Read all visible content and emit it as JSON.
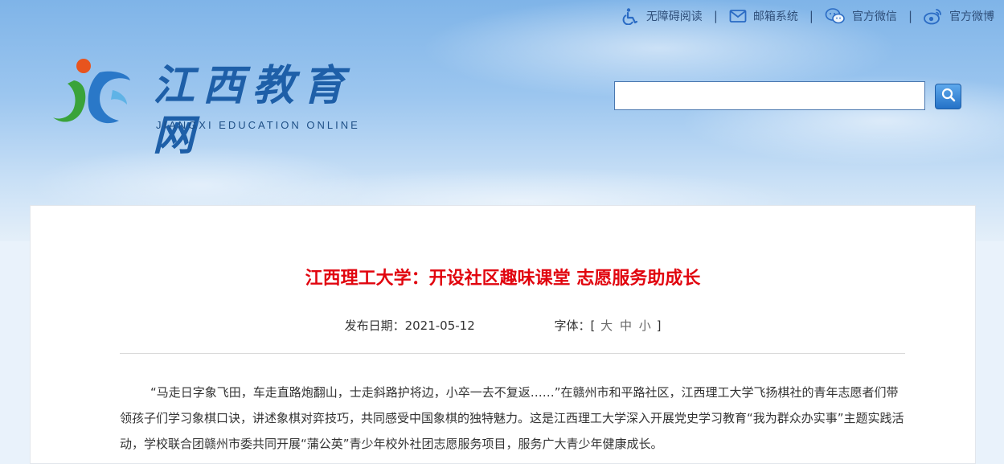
{
  "topbar": {
    "accessibility_label": "无障碍阅读",
    "email_label": "邮箱系统",
    "wechat_label": "官方微信",
    "weibo_label": "官方微博",
    "separator": "|"
  },
  "logo": {
    "title": "江西教育网",
    "subtitle": "JIANGXI EDUCATION ONLINE"
  },
  "search": {
    "value": "",
    "placeholder": ""
  },
  "article": {
    "title": "江西理工大学：开设社区趣味课堂 志愿服务助成长",
    "date_label": "发布日期：2021-05-12",
    "font_label": "字体：[",
    "font_options": [
      "大",
      "中",
      "小"
    ],
    "font_close": "]",
    "paragraph": "“马走日字象飞田，车走直路炮翻山，士走斜路护将边，小卒一去不复返……”在赣州市和平路社区，江西理工大学飞扬棋社的青年志愿者们带领孩子们学习象棋口诀，讲述象棋对弈技巧，共同感受中国象棋的独特魅力。这是江西理工大学深入开展党史学习教育“我为群众办实事”主题实践活动，学校联合团赣州市委共同开展“蒲公英”青少年校外社团志愿服务项目，服务广大青少年健康成长。"
  },
  "colors": {
    "title_red": "#e1050f",
    "brand_blue": "#1e5fa8"
  },
  "icons": [
    "accessibility-icon",
    "mail-icon",
    "wechat-icon",
    "weibo-icon",
    "search-icon",
    "logo-mark"
  ]
}
